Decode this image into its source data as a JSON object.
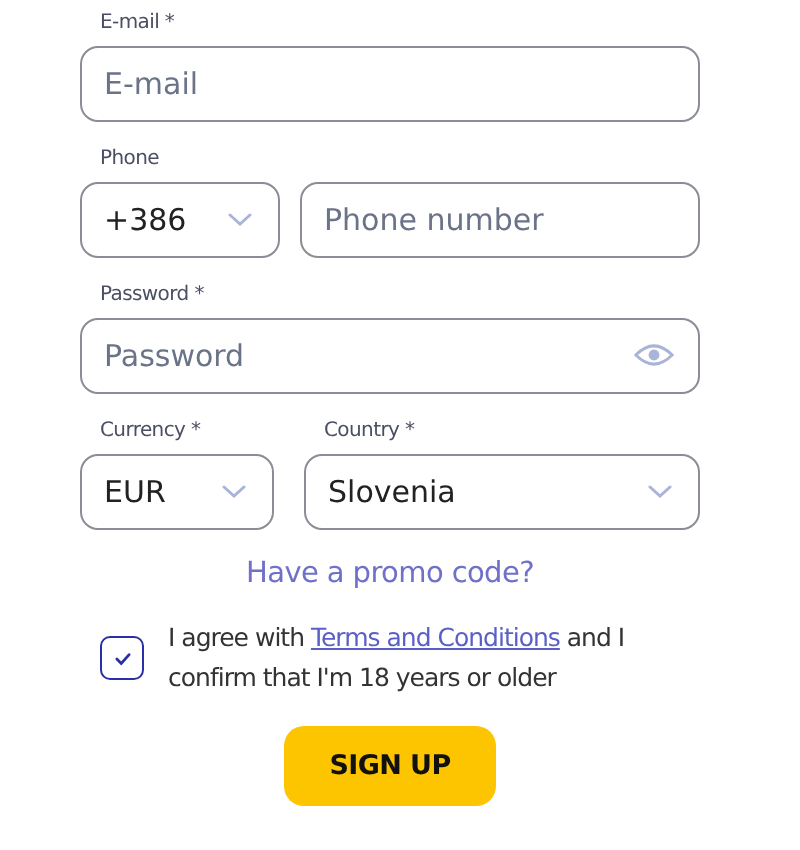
{
  "email": {
    "label": "E-mail *",
    "placeholder": "E-mail"
  },
  "phone": {
    "label": "Phone",
    "code": "+386",
    "placeholder": "Phone number"
  },
  "password": {
    "label": "Password *",
    "placeholder": "Password"
  },
  "currency": {
    "label": "Currency *",
    "value": "EUR"
  },
  "country": {
    "label": "Country *",
    "value": "Slovenia"
  },
  "promo_link": "Have a promo code?",
  "agreement": {
    "checked": true,
    "text_before": "I agree with ",
    "link": "Terms and Conditions",
    "text_after": " and I confirm that I'm 18 years or older"
  },
  "signup_button": "SIGN UP"
}
